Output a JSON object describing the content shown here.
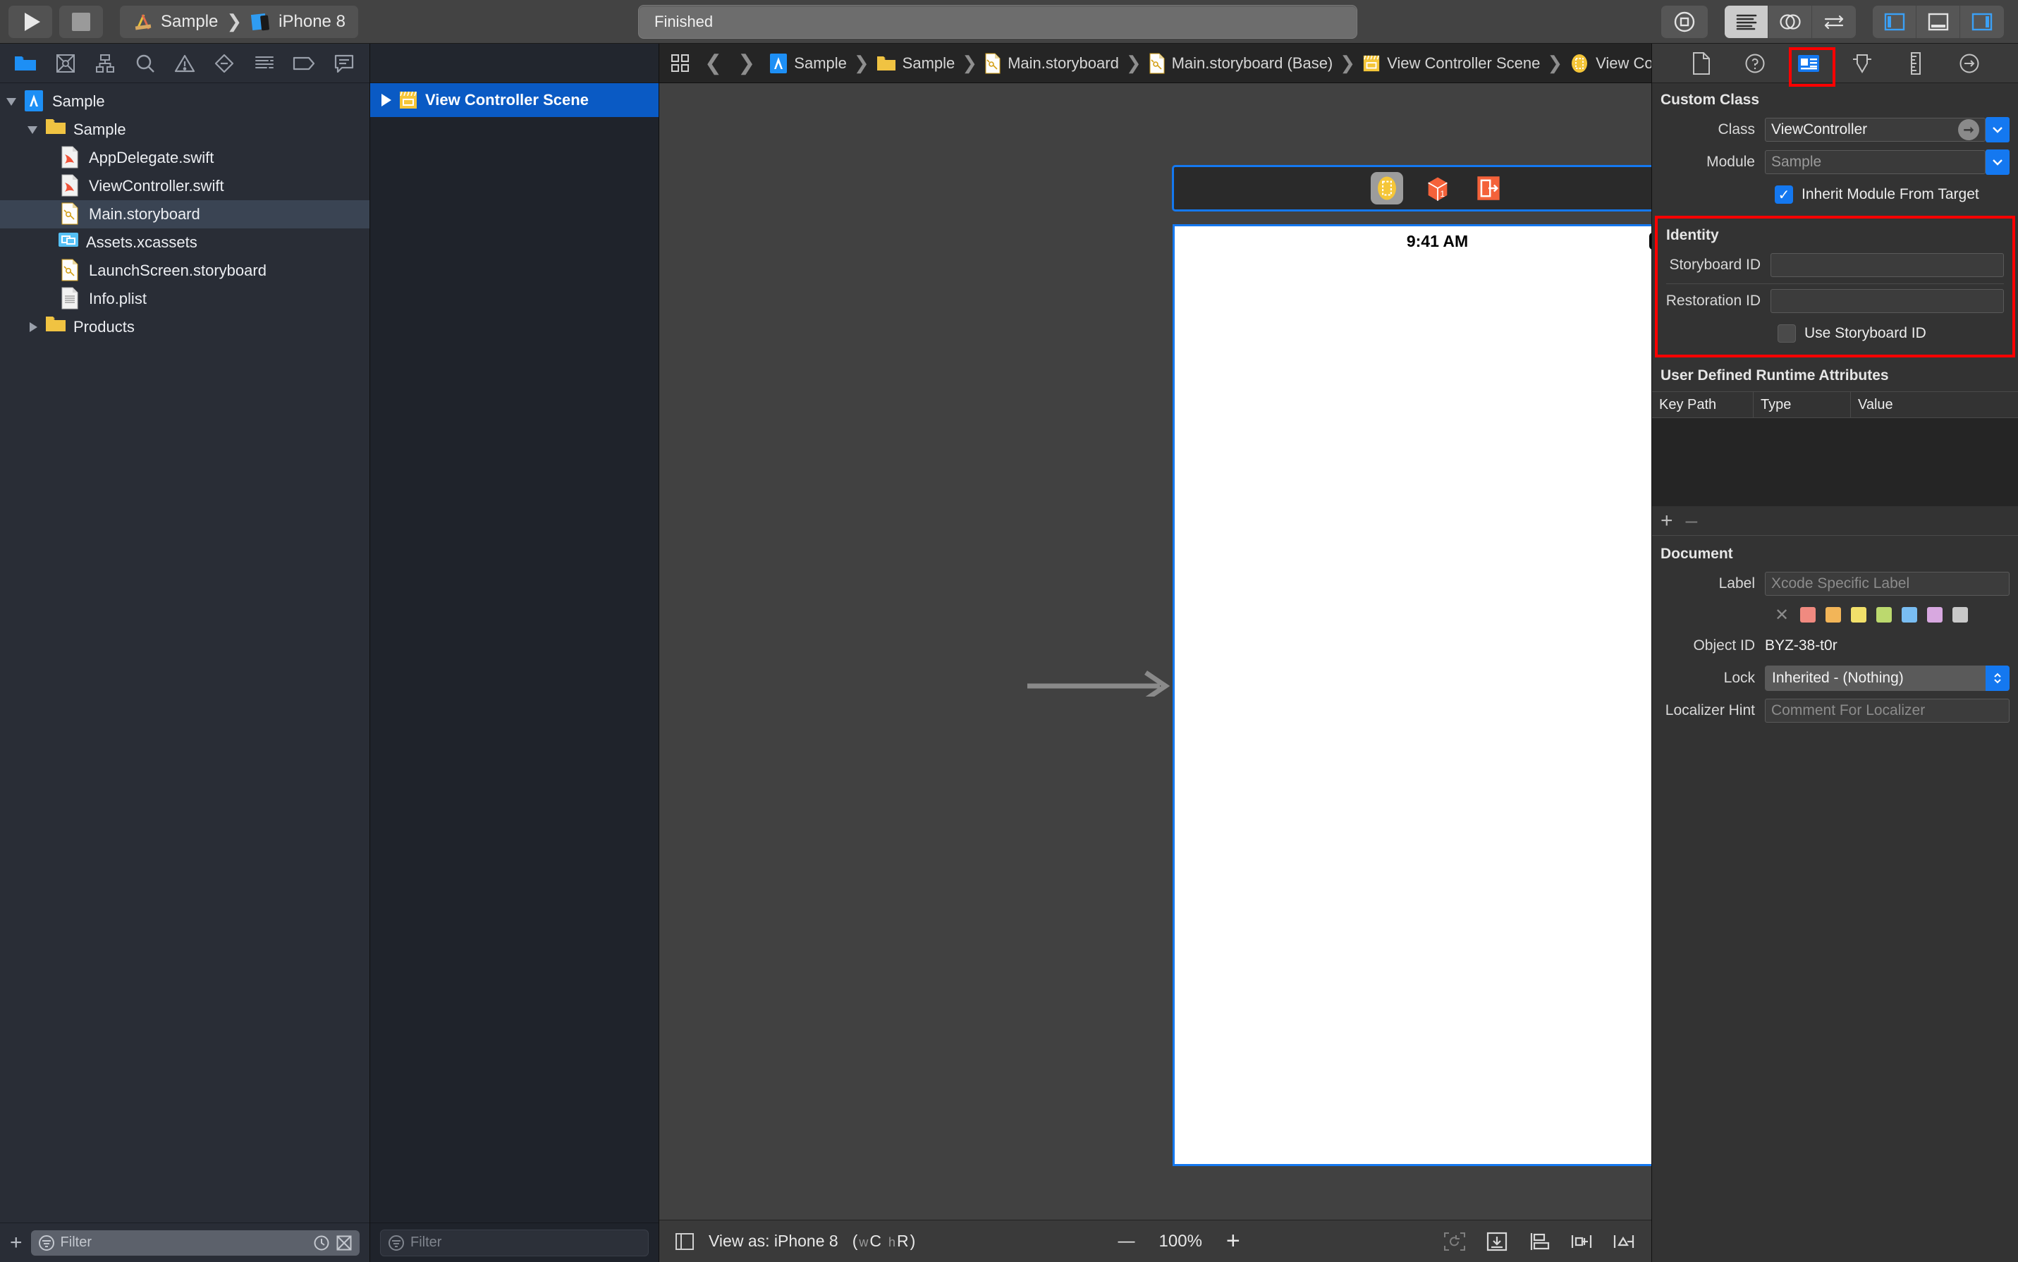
{
  "toolbar": {
    "run_label": "run-button",
    "stop_label": "stop-button",
    "scheme_project": "Sample",
    "scheme_sep": "❯",
    "scheme_device": "iPhone 8",
    "status_text": "Finished"
  },
  "navigator": {
    "tabs": [
      "project-navigator-icon",
      "source-control-navigator-icon",
      "symbol-navigator-icon",
      "find-navigator-icon",
      "issue-navigator-icon",
      "test-navigator-icon",
      "debug-navigator-icon",
      "breakpoint-navigator-icon",
      "report-navigator-icon"
    ],
    "tree": [
      {
        "label": "Sample",
        "depth": 0,
        "icon": "xcodeproj",
        "disclosure": "open",
        "selected": false
      },
      {
        "label": "Sample",
        "depth": 1,
        "icon": "folder",
        "disclosure": "open",
        "selected": false
      },
      {
        "label": "AppDelegate.swift",
        "depth": 2,
        "icon": "swift",
        "disclosure": "none",
        "selected": false
      },
      {
        "label": "ViewController.swift",
        "depth": 2,
        "icon": "swift",
        "disclosure": "none",
        "selected": false
      },
      {
        "label": "Main.storyboard",
        "depth": 2,
        "icon": "storyboard",
        "disclosure": "none",
        "selected": true
      },
      {
        "label": "Assets.xcassets",
        "depth": 2,
        "icon": "xcassets",
        "disclosure": "none",
        "selected": false
      },
      {
        "label": "LaunchScreen.storyboard",
        "depth": 2,
        "icon": "storyboard",
        "disclosure": "none",
        "selected": false
      },
      {
        "label": "Info.plist",
        "depth": 2,
        "icon": "plist",
        "disclosure": "none",
        "selected": false
      },
      {
        "label": "Products",
        "depth": 1,
        "icon": "folder",
        "disclosure": "closed",
        "selected": false
      }
    ],
    "filter_placeholder": "Filter",
    "add_label": "+"
  },
  "outline": {
    "items": [
      {
        "label": "View Controller Scene",
        "selected": true
      }
    ],
    "filter_placeholder": "Filter"
  },
  "breadcrumb": {
    "grid_icon": "assistant-grid-icon",
    "back": "❮",
    "forward": "❯",
    "items": [
      {
        "label": "Sample",
        "icon": "xcodeproj"
      },
      {
        "label": "Sample",
        "icon": "folder"
      },
      {
        "label": "Main.storyboard",
        "icon": "storyboard"
      },
      {
        "label": "Main.storyboard (Base)",
        "icon": "storyboard"
      },
      {
        "label": "View Controller Scene",
        "icon": "scene"
      },
      {
        "label": "View Controller",
        "icon": "viewcontroller"
      }
    ],
    "separator": "❯"
  },
  "canvas": {
    "dock_icons": [
      "view-controller-icon",
      "first-responder-icon",
      "exit-icon"
    ],
    "device_time": "9:41 AM",
    "bottom_bar": {
      "toggle_label": "document-outline-toggle",
      "view_as": "View as: iPhone 8",
      "view_as_sub_w": "w",
      "view_as_sub_c": "C",
      "view_as_sub_h": "h",
      "view_as_sub_r": "R",
      "view_as_paren_open": "(",
      "view_as_paren_close": ")",
      "zoom_out": "—",
      "zoom_level": "100%",
      "zoom_in": "+",
      "right_icons": [
        "update-frames-icon",
        "resolve-auto-layout-icon",
        "align-icon",
        "pin-icon",
        "add-constraints-icon"
      ]
    }
  },
  "inspector": {
    "tabs": [
      "file-inspector-icon",
      "quick-help-inspector-icon",
      "identity-inspector-icon",
      "attributes-inspector-icon",
      "size-inspector-icon",
      "connections-inspector-icon"
    ],
    "active_tab_index": 2,
    "custom_class": {
      "title": "Custom Class",
      "class_label": "Class",
      "class_value": "ViewController",
      "module_label": "Module",
      "module_value": "Sample",
      "inherit_label": "Inherit Module From Target",
      "inherit_checked": true
    },
    "identity": {
      "title": "Identity",
      "storyboard_id_label": "Storyboard ID",
      "storyboard_id_value": "",
      "restoration_id_label": "Restoration ID",
      "restoration_id_value": "",
      "use_storyboard_id_label": "Use Storyboard ID",
      "use_storyboard_id_checked": false
    },
    "udra": {
      "title": "User Defined Runtime Attributes",
      "columns": [
        "Key Path",
        "Type",
        "Value"
      ],
      "rows": [],
      "add_label": "+",
      "remove_label": "–"
    },
    "document": {
      "title": "Document",
      "label_label": "Label",
      "label_placeholder": "Xcode Specific Label",
      "label_value": "",
      "swatch_clear": "✕",
      "swatches": [
        "#f08a80",
        "#f2b558",
        "#f2e06a",
        "#bcd96e",
        "#79bdf2",
        "#d8a8e0",
        "#c9c9c9"
      ],
      "object_id_label": "Object ID",
      "object_id_value": "BYZ-38-t0r",
      "lock_label": "Lock",
      "lock_value": "Inherited - (Nothing)",
      "localizer_hint_label": "Localizer Hint",
      "localizer_hint_placeholder": "Comment For Localizer",
      "localizer_hint_value": ""
    }
  },
  "colors": {
    "accent_blue": "#1478f0",
    "annotation_red": "#ff0000",
    "selection_blue": "#0a5ac4"
  }
}
